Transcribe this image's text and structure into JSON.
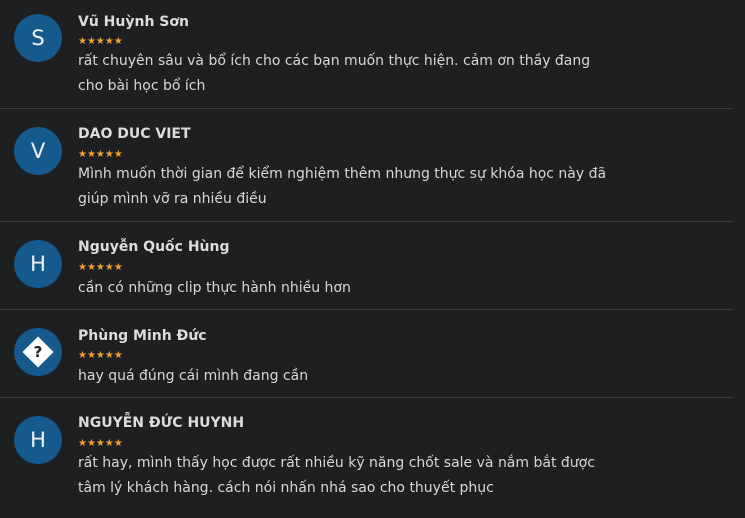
{
  "star_glyph": "★★★★★",
  "colors": {
    "background": "#1e1f21",
    "avatar": "#145a8c",
    "star": "#f0a030",
    "divider": "#3b3c3f"
  },
  "reviews": [
    {
      "avatar_letter": "S",
      "name": "Vũ Huỳnh Sơn",
      "rating": 5,
      "comment": "rất chuyên sâu và bổ ích cho các bạn muốn thực hiện. cảm ơn thầy đang cho bài học bổ ích"
    },
    {
      "avatar_letter": "V",
      "name": "DAO DUC VIET",
      "rating": 5,
      "comment": "Mình muốn thời gian để kiểm nghiệm thêm nhưng thực sự khóa học này đã giúp mình vỡ ra nhiều điều"
    },
    {
      "avatar_letter": "H",
      "name": "Nguyễn Quốc Hùng",
      "rating": 5,
      "comment": "cần có những clip thực hành nhiều hơn"
    },
    {
      "avatar_letter": "?",
      "name": "Phùng Minh Đức",
      "rating": 5,
      "comment": "hay quá đúng cái mình đang cần"
    },
    {
      "avatar_letter": "H",
      "name": "NGUYỄN ĐỨC HUYNH",
      "rating": 5,
      "comment": "rất hay, mình thấy học được rất nhiều kỹ năng chốt sale và nắm bắt được tâm lý khách hàng. cách nói nhấn nhá sao cho thuyết phục"
    }
  ]
}
